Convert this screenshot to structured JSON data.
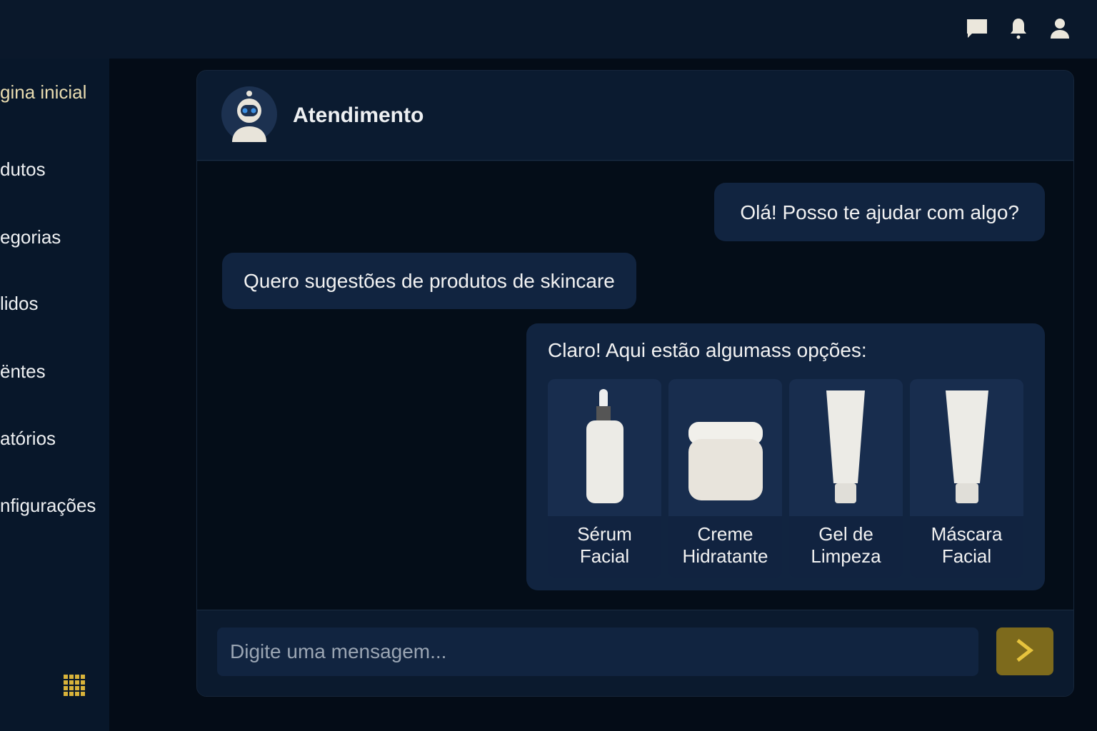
{
  "topbar": {
    "icons": [
      "chat-icon",
      "bell-icon",
      "user-icon"
    ]
  },
  "sidebar": {
    "items": [
      {
        "label": "gina inicial",
        "active": true
      },
      {
        "label": "dutos"
      },
      {
        "label": "egorias"
      },
      {
        "label": "lidos"
      },
      {
        "label": "ëntes"
      },
      {
        "label": "atórios"
      },
      {
        "label": "nfigurações"
      }
    ],
    "apps_icon": "grid-icon"
  },
  "chat": {
    "title": "Atendimento",
    "messages": [
      {
        "text": "Olá! Posso te ajudar com algo?"
      },
      {
        "text": "Quero sugestões de produtos de skincare"
      },
      {
        "text": "Claro! Aqui estão algumass opções:"
      }
    ],
    "products": [
      {
        "line1": "Sérum",
        "line2": "Facial"
      },
      {
        "line1": "Creme",
        "line2": "Hidratante"
      },
      {
        "line1": "Gel de",
        "line2": "Limpeza"
      },
      {
        "line1": "Máscara",
        "line2": "Facial"
      }
    ],
    "input_placeholder": "Digite uma mensagem...",
    "accent": "#7d6a1c"
  }
}
